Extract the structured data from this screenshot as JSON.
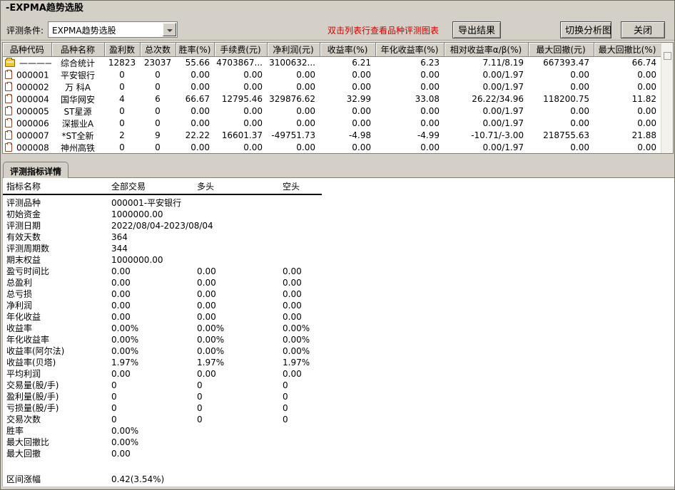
{
  "window": {
    "title": "-EXPMA趋势选股"
  },
  "toolbar": {
    "condition_label": "评测条件:",
    "condition_value": "EXPMA趋势选股",
    "hint": "双击列表行查看品种评测图表",
    "hint_color": "#d40000",
    "export_button": "导出结果",
    "switch_button": "切换分析图",
    "close_button": "关闭"
  },
  "results_table": {
    "columns": [
      "品种代码",
      "品种名称",
      "盈利数",
      "总次数",
      "胜率(%)",
      "手续费(元)",
      "净利润(元)",
      "收益率(%)",
      "年化收益率(%)",
      "相对收益率α/β(%)",
      "最大回撤(元)",
      "最大回撤比(%)"
    ],
    "rows": [
      {
        "icon": "folder-icon",
        "code": "————",
        "name": "综合统计",
        "values": [
          "12823",
          "23037",
          "55.66",
          "4703867...",
          "3100632...",
          "6.21",
          "6.23",
          "7.11/8.19",
          "667393.47",
          "66.74"
        ]
      },
      {
        "icon": "document-icon",
        "code": "000001",
        "name": "平安银行",
        "values": [
          "0",
          "0",
          "0.00",
          "0.00",
          "0.00",
          "0.00",
          "0.00",
          "0.00/1.97",
          "0.00",
          "0.00"
        ]
      },
      {
        "icon": "document-icon",
        "code": "000002",
        "name": "万 科A",
        "values": [
          "0",
          "0",
          "0.00",
          "0.00",
          "0.00",
          "0.00",
          "0.00",
          "0.00/1.97",
          "0.00",
          "0.00"
        ]
      },
      {
        "icon": "document-icon",
        "code": "000004",
        "name": "国华网安",
        "values": [
          "4",
          "6",
          "66.67",
          "12795.46",
          "329876.62",
          "32.99",
          "33.08",
          "26.22/34.96",
          "118200.75",
          "11.82"
        ]
      },
      {
        "icon": "document-icon",
        "code": "000005",
        "name": "ST星源",
        "values": [
          "0",
          "0",
          "0.00",
          "0.00",
          "0.00",
          "0.00",
          "0.00",
          "0.00/1.97",
          "0.00",
          "0.00"
        ]
      },
      {
        "icon": "document-icon",
        "code": "000006",
        "name": "深振业A",
        "values": [
          "0",
          "0",
          "0.00",
          "0.00",
          "0.00",
          "0.00",
          "0.00",
          "0.00/1.97",
          "0.00",
          "0.00"
        ]
      },
      {
        "icon": "document-icon",
        "code": "000007",
        "name": "*ST全新",
        "values": [
          "2",
          "9",
          "22.22",
          "16601.37",
          "-49751.73",
          "-4.98",
          "-4.99",
          "-10.71/-3.00",
          "218755.63",
          "21.88"
        ]
      },
      {
        "icon": "document-icon",
        "code": "000008",
        "name": "神州高铁",
        "values": [
          "0",
          "0",
          "0.00",
          "0.00",
          "0.00",
          "0.00",
          "0.00",
          "0.00/1.97",
          "0.00",
          "0.00"
        ]
      }
    ]
  },
  "details": {
    "tab_label": "评测指标详情",
    "columns": [
      "指标名称",
      "全部交易",
      "多头",
      "空头"
    ],
    "rows": [
      {
        "label": "评测品种",
        "all": "000001-平安银行",
        "long": "",
        "short": ""
      },
      {
        "label": "初始资金",
        "all": "1000000.00",
        "long": "",
        "short": ""
      },
      {
        "label": "评测日期",
        "all": "2022/08/04-2023/08/04",
        "long": "",
        "short": ""
      },
      {
        "label": "有效天数",
        "all": "364",
        "long": "",
        "short": ""
      },
      {
        "label": "评测周期数",
        "all": "344",
        "long": "",
        "short": ""
      },
      {
        "label": "期末权益",
        "all": "1000000.00",
        "long": "",
        "short": ""
      },
      {
        "label": "盈亏时间比",
        "all": "0.00",
        "long": "0.00",
        "short": "0.00"
      },
      {
        "label": "总盈利",
        "all": "0.00",
        "long": "0.00",
        "short": "0.00"
      },
      {
        "label": "总亏损",
        "all": "0.00",
        "long": "0.00",
        "short": "0.00"
      },
      {
        "label": "净利润",
        "all": "0.00",
        "long": "0.00",
        "short": "0.00"
      },
      {
        "label": "年化收益",
        "all": "0.00",
        "long": "0.00",
        "short": "0.00"
      },
      {
        "label": "收益率",
        "all": "0.00%",
        "long": "0.00%",
        "short": "0.00%"
      },
      {
        "label": "年化收益率",
        "all": "0.00%",
        "long": "0.00%",
        "short": "0.00%"
      },
      {
        "label": "收益率(阿尔法)",
        "all": "0.00%",
        "long": "0.00%",
        "short": "0.00%"
      },
      {
        "label": "收益率(贝塔)",
        "all": "1.97%",
        "long": "1.97%",
        "short": "1.97%"
      },
      {
        "label": "平均利润",
        "all": "0.00",
        "long": "0.00",
        "short": "0.00"
      },
      {
        "label": "交易量(股/手)",
        "all": "0",
        "long": "0",
        "short": "0"
      },
      {
        "label": "盈利量(股/手)",
        "all": "0",
        "long": "0",
        "short": "0"
      },
      {
        "label": "亏损量(股/手)",
        "all": "0",
        "long": "0",
        "short": "0"
      },
      {
        "label": "交易次数",
        "all": "0",
        "long": "0",
        "short": "0"
      },
      {
        "label": "胜率",
        "all": "0.00%",
        "long": "",
        "short": ""
      },
      {
        "label": "最大回撤比",
        "all": "0.00%",
        "long": "",
        "short": ""
      },
      {
        "label": "最大回撤",
        "all": "0.00",
        "long": "",
        "short": ""
      },
      {
        "label": "",
        "all": "",
        "long": "",
        "short": "",
        "spacer": true
      },
      {
        "label": "区间涨幅",
        "all": "0.42(3.54%)",
        "long": "",
        "short": ""
      }
    ]
  },
  "colors": {
    "window_bg": "#d4d0c8",
    "table_bg": "#ffffff",
    "hint_red": "#d40000",
    "folder_icon_fill": "#f2c438",
    "document_icon_border": "#9a4226"
  }
}
